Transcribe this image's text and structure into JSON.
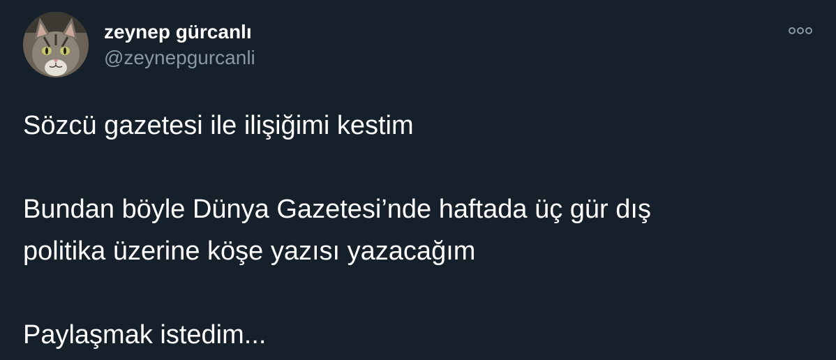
{
  "user": {
    "name": "zeynep gürcanlı",
    "handle": "@zeynepgurcanli",
    "avatar_icon": "cat-avatar-icon"
  },
  "tweet": {
    "line1": "Sözcü gazetesi ile ilişiğimi kestim",
    "line2": "Bundan böyle Dünya Gazetesi’nde haftada üç gür dış",
    "line3": "politika üzerine köşe yazısı yazacağım",
    "line4": "Paylaşmak istedim..."
  },
  "menu": {
    "icon": "more-options-icon"
  },
  "colors": {
    "background": "#15202b",
    "text": "#ffffff",
    "secondary_text": "#8899a6"
  }
}
